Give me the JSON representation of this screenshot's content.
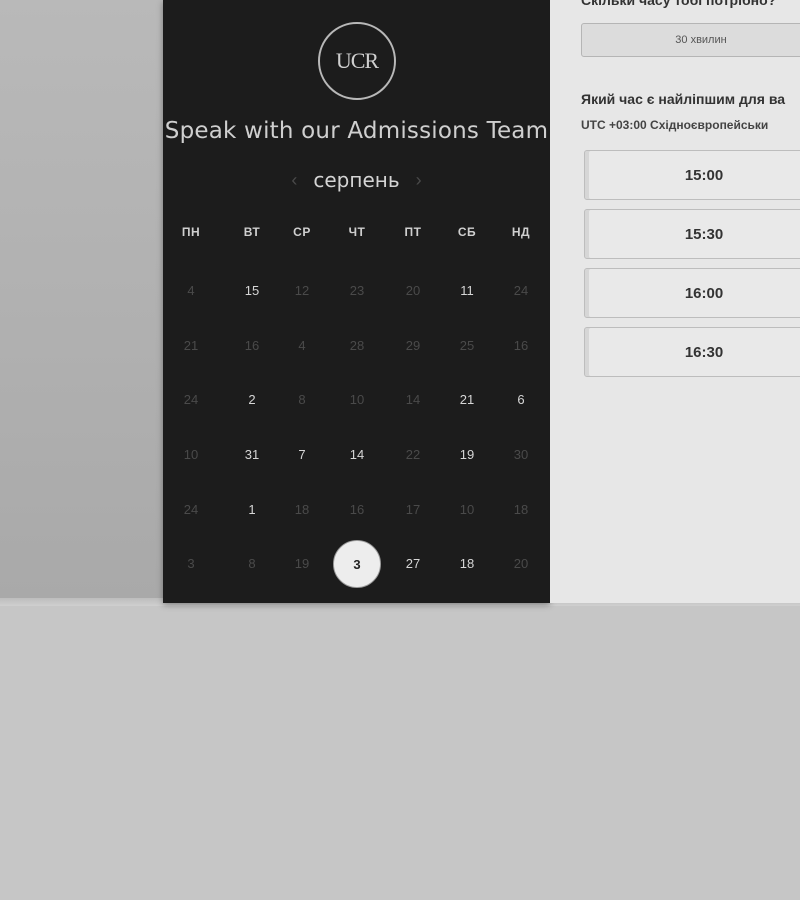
{
  "scheduler": {
    "logo_text": "UCR",
    "title": "Speak with our Admissions Team",
    "month": "серпень",
    "prev_arrow": "‹",
    "next_arrow": "›",
    "weekdays": [
      "ПН",
      "ВТ",
      "СР",
      "ЧТ",
      "ПТ",
      "СБ",
      "НД"
    ],
    "weeks": [
      [
        {
          "d": "4",
          "a": false
        },
        {
          "d": "15",
          "a": true
        },
        {
          "d": "12",
          "a": false
        },
        {
          "d": "23",
          "a": false
        },
        {
          "d": "20",
          "a": false
        },
        {
          "d": "11",
          "a": true
        },
        {
          "d": "24",
          "a": false
        }
      ],
      [
        {
          "d": "21",
          "a": false
        },
        {
          "d": "16",
          "a": false
        },
        {
          "d": "4",
          "a": false
        },
        {
          "d": "28",
          "a": false
        },
        {
          "d": "29",
          "a": false
        },
        {
          "d": "25",
          "a": false
        },
        {
          "d": "16",
          "a": false
        }
      ],
      [
        {
          "d": "24",
          "a": false
        },
        {
          "d": "2",
          "a": true
        },
        {
          "d": "8",
          "a": false
        },
        {
          "d": "10",
          "a": false
        },
        {
          "d": "14",
          "a": false
        },
        {
          "d": "21",
          "a": true
        },
        {
          "d": "6",
          "a": true
        }
      ],
      [
        {
          "d": "10",
          "a": false
        },
        {
          "d": "31",
          "a": true
        },
        {
          "d": "7",
          "a": true
        },
        {
          "d": "14",
          "a": true
        },
        {
          "d": "22",
          "a": false
        },
        {
          "d": "19",
          "a": true
        },
        {
          "d": "30",
          "a": false
        }
      ],
      [
        {
          "d": "24",
          "a": false
        },
        {
          "d": "1",
          "a": true
        },
        {
          "d": "18",
          "a": false
        },
        {
          "d": "16",
          "a": false
        },
        {
          "d": "17",
          "a": false
        },
        {
          "d": "10",
          "a": false
        },
        {
          "d": "18",
          "a": false
        }
      ],
      [
        {
          "d": "3",
          "a": false
        },
        {
          "d": "8",
          "a": false
        },
        {
          "d": "19",
          "a": false
        },
        {
          "d": "3",
          "a": true,
          "selected": true
        },
        {
          "d": "27",
          "a": true
        },
        {
          "d": "18",
          "a": true
        },
        {
          "d": "20",
          "a": false
        }
      ]
    ]
  },
  "booking": {
    "duration_question": "Скільки часу тобі потрібно?",
    "duration_value": "30 хвилин",
    "time_question": "Який час є найліпшим для ва",
    "timezone": "UTC +03:00 Східноєвропейськи",
    "slots": [
      "15:00",
      "15:30",
      "16:00",
      "16:30"
    ]
  },
  "colors": {
    "panel_dark": "#1c1c1c",
    "panel_light": "#e7e7e7",
    "selected_day": "#ededed"
  }
}
